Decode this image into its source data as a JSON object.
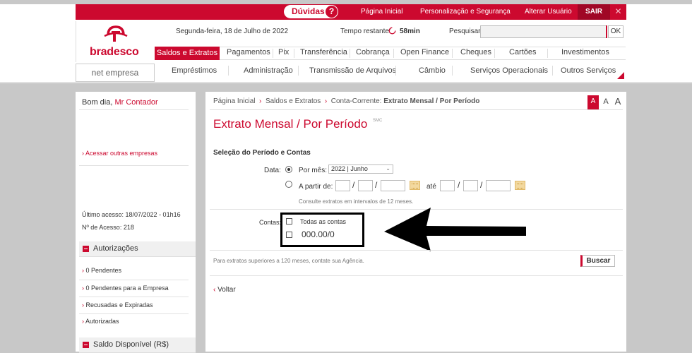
{
  "topbar": {
    "duvidas": "Dúvidas",
    "links": [
      "Página Inicial",
      "Personalização e Segurança",
      "Alterar Usuário"
    ],
    "sair": "SAIR",
    "close": "✕"
  },
  "brand": {
    "name": "bradesco",
    "subtitle": "net empresa",
    "accent": "#cc092f"
  },
  "header": {
    "date": "Segunda-feira, 18 de Julho de 2022",
    "time_label": "Tempo restante:",
    "time_value": "58min",
    "search_label": "Pesquisar:",
    "search_value": "",
    "ok": "OK"
  },
  "menu1": [
    "Saldos e Extratos",
    "Pagamentos",
    "Pix",
    "Transferência",
    "Cobrança",
    "Open Finance",
    "Cheques",
    "Cartões",
    "Investimentos"
  ],
  "menu2": [
    "Empréstimos",
    "Administração",
    "Transmissão de Arquivos",
    "Câmbio",
    "Serviços Operacionais",
    "Outros Serviços"
  ],
  "sidebar": {
    "greeting": "Bom dia, ",
    "user": "Mr Contador",
    "other_companies": "Acessar outras empresas",
    "last_access": "Último acesso: 18/07/2022 - 01h16",
    "access_no": "Nº de Acesso: 218",
    "auth_title": "Autorizações",
    "auth_items": [
      "0 Pendentes",
      "0 Pendentes para a Empresa",
      "Recusadas e Expiradas",
      "Autorizadas"
    ],
    "balance_title": "Saldo Disponível (R$)"
  },
  "breadcrumb": {
    "home": "Página Inicial",
    "section": "Saldos e Extratos",
    "current_prefix": "Conta-Corrente: ",
    "current": "Extrato Mensal / Por Período"
  },
  "font_sizes": [
    "A",
    "A",
    "A"
  ],
  "main": {
    "title": "Extrato Mensal / Por Período",
    "title_code": "SMC",
    "section": "Seleção do Período e Contas",
    "date_label": "Data:",
    "por_mes": "Por mês:",
    "month_value": "2022 | Junho",
    "a_partir": "A partir de:",
    "ate": "até",
    "hint": "Consulte extratos em intervalos de 12 meses.",
    "contas_label": "Contas:",
    "all_accounts": "Todas as contas",
    "account": "000.00/0",
    "footnote": "Para extratos superiores a 120 meses, contate sua Agência.",
    "buscar": "Buscar",
    "voltar": "Voltar"
  }
}
